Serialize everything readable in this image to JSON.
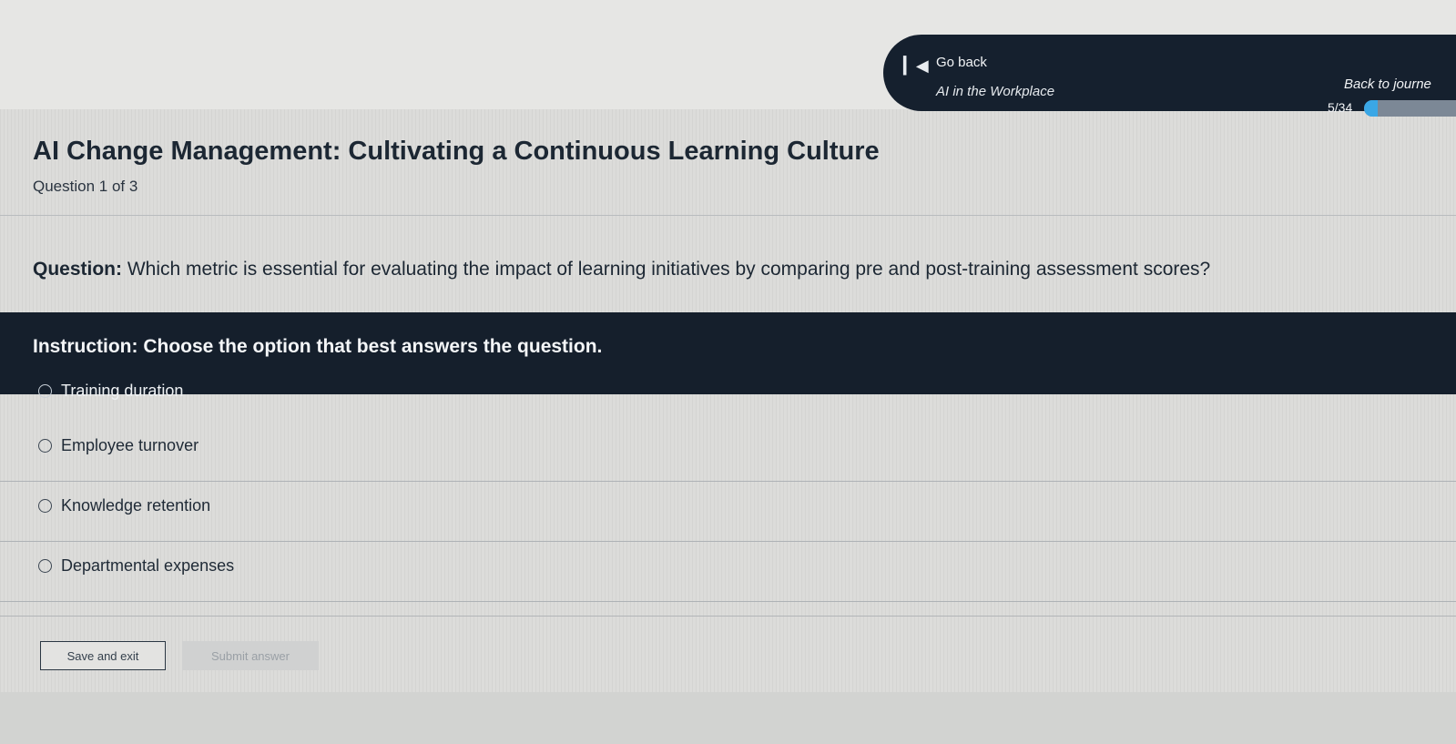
{
  "nav": {
    "go_back_label": "Go back",
    "back_icon": "skip-back-icon",
    "course_title": "AI in the Workplace",
    "journey_label": "Back to journe",
    "progress_text": "5/34",
    "progress_fraction": 0.147
  },
  "quiz": {
    "title": "AI Change Management: Cultivating a Continuous Learning Culture",
    "counter": "Question 1 of 3",
    "question_label": "Question:",
    "question_text": "Which metric is essential for evaluating the impact of learning initiatives by comparing pre and post-training assessment scores?",
    "instruction": "Instruction: Choose the option that best answers the question.",
    "options": [
      {
        "label": "Training duration"
      },
      {
        "label": "Employee turnover"
      },
      {
        "label": "Knowledge retention"
      },
      {
        "label": "Departmental expenses"
      }
    ]
  },
  "actions": {
    "save_label": "Save and exit",
    "submit_label": "Submit answer"
  },
  "colors": {
    "navy": "#15202e",
    "accent": "#3aa7e6"
  }
}
